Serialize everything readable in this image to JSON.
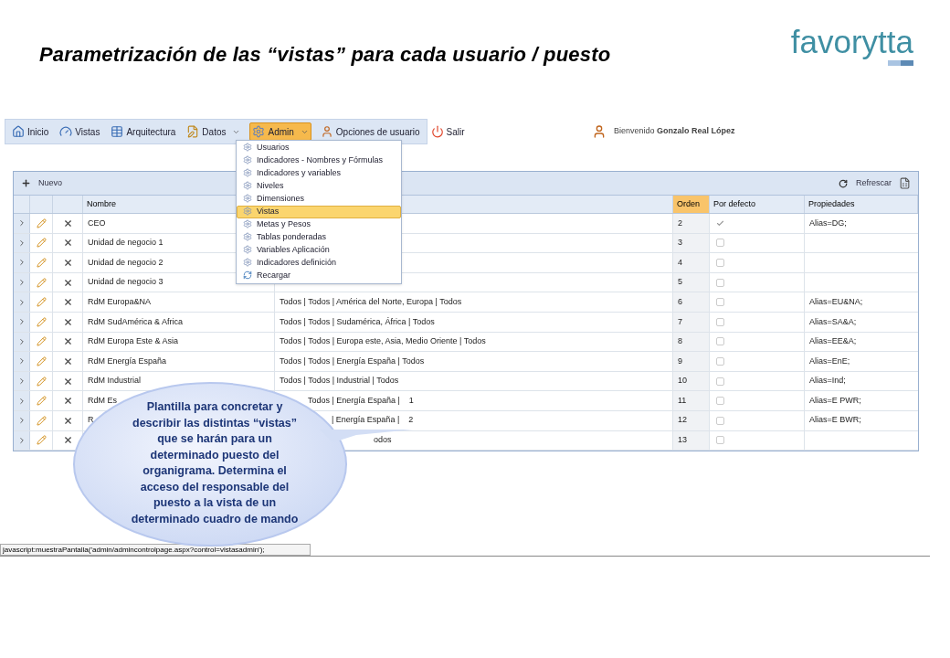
{
  "slide_title": "Parametrización de las “vistas” para cada usuario / puesto",
  "logo": {
    "text": "favorytta"
  },
  "toolbar": {
    "items": [
      {
        "label": "Inicio",
        "dropdown": false,
        "selected": false
      },
      {
        "label": "Vistas",
        "dropdown": false,
        "selected": false
      },
      {
        "label": "Arquitectura",
        "dropdown": false,
        "selected": false
      },
      {
        "label": "Datos",
        "dropdown": true,
        "selected": false
      },
      {
        "label": "Admin",
        "dropdown": true,
        "selected": true
      },
      {
        "label": "Opciones de usuario",
        "dropdown": false,
        "selected": false
      },
      {
        "label": "Salir",
        "dropdown": false,
        "selected": false
      }
    ],
    "welcome": "Bienvenido **Gonzalo Real López**"
  },
  "admin_menu": {
    "items": [
      {
        "label": "Usuarios",
        "kind": "gear",
        "selected": false
      },
      {
        "label": "Indicadores - Nombres y Fórmulas",
        "kind": "gear",
        "selected": false
      },
      {
        "label": "Indicadores y variables",
        "kind": "gear",
        "selected": false
      },
      {
        "label": "Niveles",
        "kind": "gear",
        "selected": false
      },
      {
        "label": "Dimensiones",
        "kind": "gear",
        "selected": false
      },
      {
        "label": "Vistas",
        "kind": "gear",
        "selected": true
      },
      {
        "label": "Metas y Pesos",
        "kind": "gear",
        "selected": false
      },
      {
        "label": "Tablas ponderadas",
        "kind": "gear",
        "selected": false
      },
      {
        "label": "Variables Aplicación",
        "kind": "gear",
        "selected": false
      },
      {
        "label": "Indicadores definición",
        "kind": "gear",
        "selected": false
      },
      {
        "label": "Recargar",
        "kind": "reload",
        "selected": false
      }
    ]
  },
  "grid": {
    "new_button": "Nuevo",
    "refresh_button": "Refrescar",
    "columns": [
      {
        "label": "Nombre",
        "selected": false
      },
      {
        "label": "Orden",
        "selected": true
      },
      {
        "label": "Por defecto",
        "selected": false
      },
      {
        "label": "Propiedades",
        "selected": false
      }
    ],
    "rows": [
      {
        "kind": "normal",
        "name": "CEO",
        "order": "2",
        "default": true,
        "properties": "Alias=DG;"
      },
      {
        "kind": "normal",
        "name": "Unidad de negocio 1",
        "order": "3",
        "default": false
      },
      {
        "kind": "normal",
        "name": "Unidad de negocio 2",
        "order": "4",
        "default": false
      },
      {
        "kind": "normal",
        "name": "Unidad de negocio 3",
        "order": "5",
        "default": false
      },
      {
        "kind": "normal",
        "name": "RdM Europa&NA",
        "filter": "Todos | Todos | América del Norte, Europa | Todos",
        "order": "6",
        "default": false,
        "properties": "Alias=EU&NA;"
      },
      {
        "kind": "normal",
        "name": "RdM SudAmérica & Africa",
        "filter": "Todos | Todos | Sudamérica, África | Todos",
        "order": "7",
        "default": false,
        "properties": "Alias=SA&A;"
      },
      {
        "kind": "normal",
        "name": "RdM Europa Este & Asia",
        "filter": "Todos | Todos | Europa este, Asia, Medio Oriente | Todos",
        "order": "8",
        "default": false,
        "properties": "Alias=EE&A;"
      },
      {
        "kind": "normal",
        "name": "RdM Energía España",
        "filter": "Todos | Todos | Energía España | Todos",
        "order": "9",
        "default": false,
        "properties": "Alias=EnE;"
      },
      {
        "kind": "normal",
        "name": "RdM Industrial",
        "filter": "Todos | Todos | Industrial | Todos",
        "order": "10",
        "default": false,
        "properties": "Alias=Ind;"
      },
      {
        "kind": "covered",
        "name": "RdM Es",
        "filter": "Todos | Energía España |",
        "note": "1",
        "order": "11",
        "default": false,
        "properties": "Alias=E PWR;"
      },
      {
        "kind": "covered",
        "name": "R",
        "filter": "| Energía España |",
        "note": "2",
        "order": "12",
        "default": false,
        "properties": "Alias=E BWR;"
      },
      {
        "kind": "covered",
        "filter": "odos",
        "order": "13",
        "default": false
      }
    ]
  },
  "callout": {
    "text": "Plantilla para concretar y describir las distintas “vistas” que se harán para un determinado puesto del organigrama. Determina el acceso del responsable del puesto a la vista de un determinado cuadro de mando"
  },
  "status_bar": "javascript:muestraPantalla('admin/admincontrolpage.aspx?control=vistasadmin');"
}
